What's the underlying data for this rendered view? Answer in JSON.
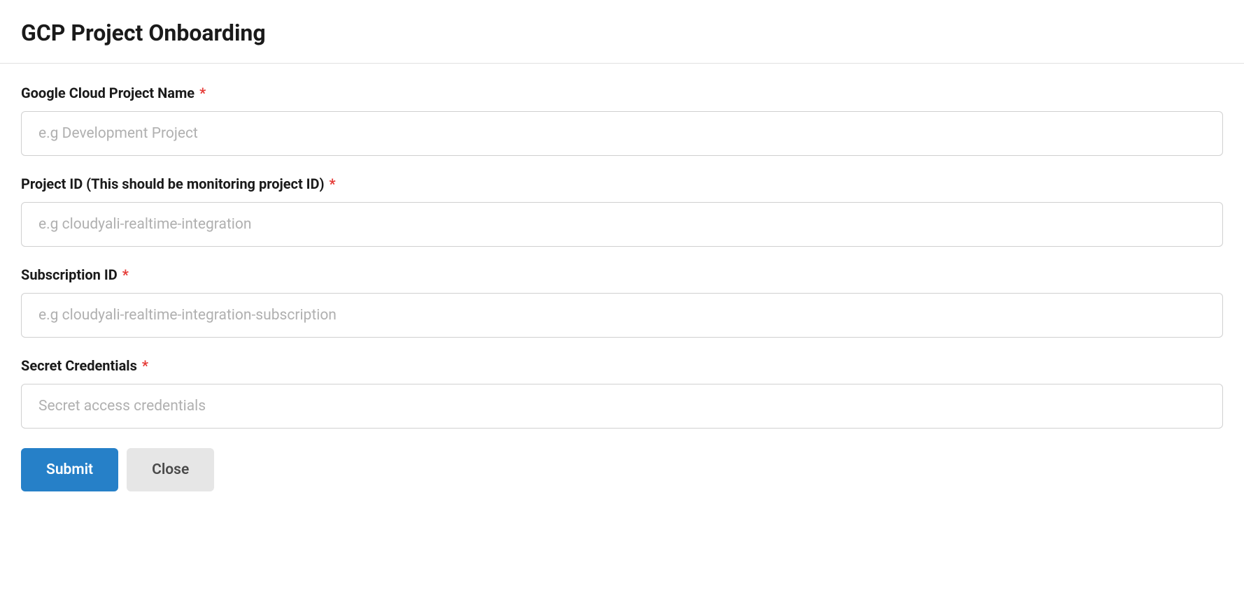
{
  "header": {
    "title": "GCP Project Onboarding"
  },
  "form": {
    "fields": [
      {
        "label": "Google Cloud Project Name",
        "required": true,
        "placeholder": "e.g Development Project",
        "value": ""
      },
      {
        "label": "Project ID (This should be monitoring project ID)",
        "required": true,
        "placeholder": "e.g cloudyali-realtime-integration",
        "value": ""
      },
      {
        "label": "Subscription ID",
        "required": true,
        "placeholder": "e.g cloudyali-realtime-integration-subscription",
        "value": ""
      },
      {
        "label": "Secret Credentials",
        "required": true,
        "placeholder": "Secret access credentials",
        "value": ""
      }
    ],
    "buttons": {
      "submit": "Submit",
      "close": "Close"
    },
    "required_marker": "*"
  }
}
